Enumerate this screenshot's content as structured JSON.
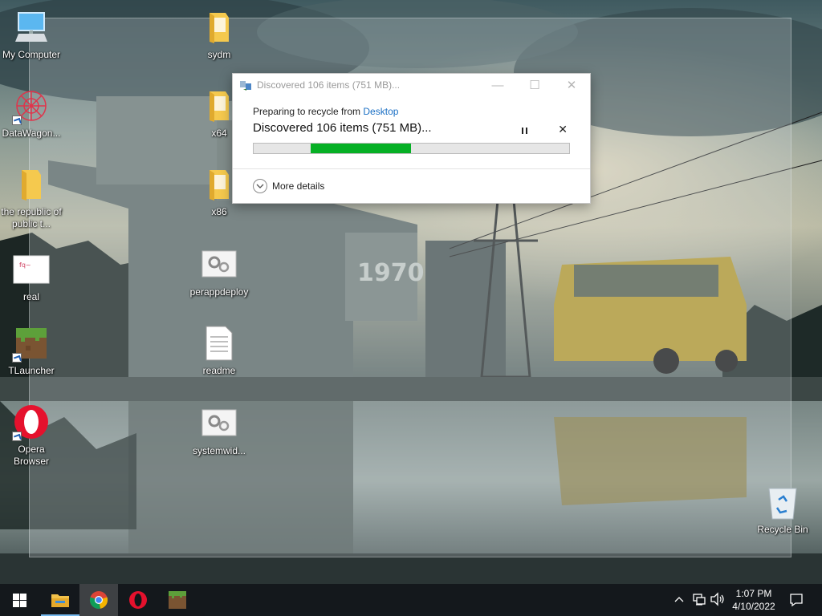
{
  "desktop": {
    "icons": [
      {
        "label": "My Computer",
        "icon": "computer-icon"
      },
      {
        "label": "DataWagon...",
        "icon": "datawagon-icon",
        "shortcut": true
      },
      {
        "label": "the republic of public t...",
        "icon": "folder-icon"
      },
      {
        "label": "real",
        "icon": "image-file-icon"
      },
      {
        "label": "TLauncher",
        "icon": "minecraft-block-icon",
        "shortcut": true
      },
      {
        "label": "Opera Browser",
        "icon": "opera-icon",
        "shortcut": true
      },
      {
        "label": "sydm",
        "icon": "folder-icon"
      },
      {
        "label": "x64",
        "icon": "folder-icon"
      },
      {
        "label": "x86",
        "icon": "folder-icon"
      },
      {
        "label": "perappdeploy",
        "icon": "settings-file-icon"
      },
      {
        "label": "readme",
        "icon": "text-file-icon"
      },
      {
        "label": "systemwid...",
        "icon": "settings-file-icon"
      },
      {
        "label": "Recycle Bin",
        "icon": "recycle-bin-icon"
      }
    ]
  },
  "dialog": {
    "title": "Discovered 106 items (751 MB)...",
    "preparing_prefix": "Preparing to recycle from ",
    "preparing_link": "Desktop",
    "heading": "Discovered 106 items (751 MB)...",
    "progress": {
      "indeterminate": true,
      "fill_start": 0.18,
      "fill_end": 0.5,
      "color": "#06b025"
    },
    "more_details": "More details"
  },
  "taskbar": {
    "apps": [
      {
        "name": "file-explorer",
        "icon": "folder-icon",
        "running": true
      },
      {
        "name": "chrome",
        "icon": "chrome-icon",
        "active": true
      },
      {
        "name": "opera",
        "icon": "opera-icon"
      },
      {
        "name": "tlauncher",
        "icon": "minecraft-block-icon"
      }
    ],
    "tray": {
      "chevron": "^",
      "icons": [
        "network-icon",
        "volume-icon"
      ]
    },
    "clock": {
      "time": "1:07 PM",
      "date": "4/10/2022"
    }
  }
}
